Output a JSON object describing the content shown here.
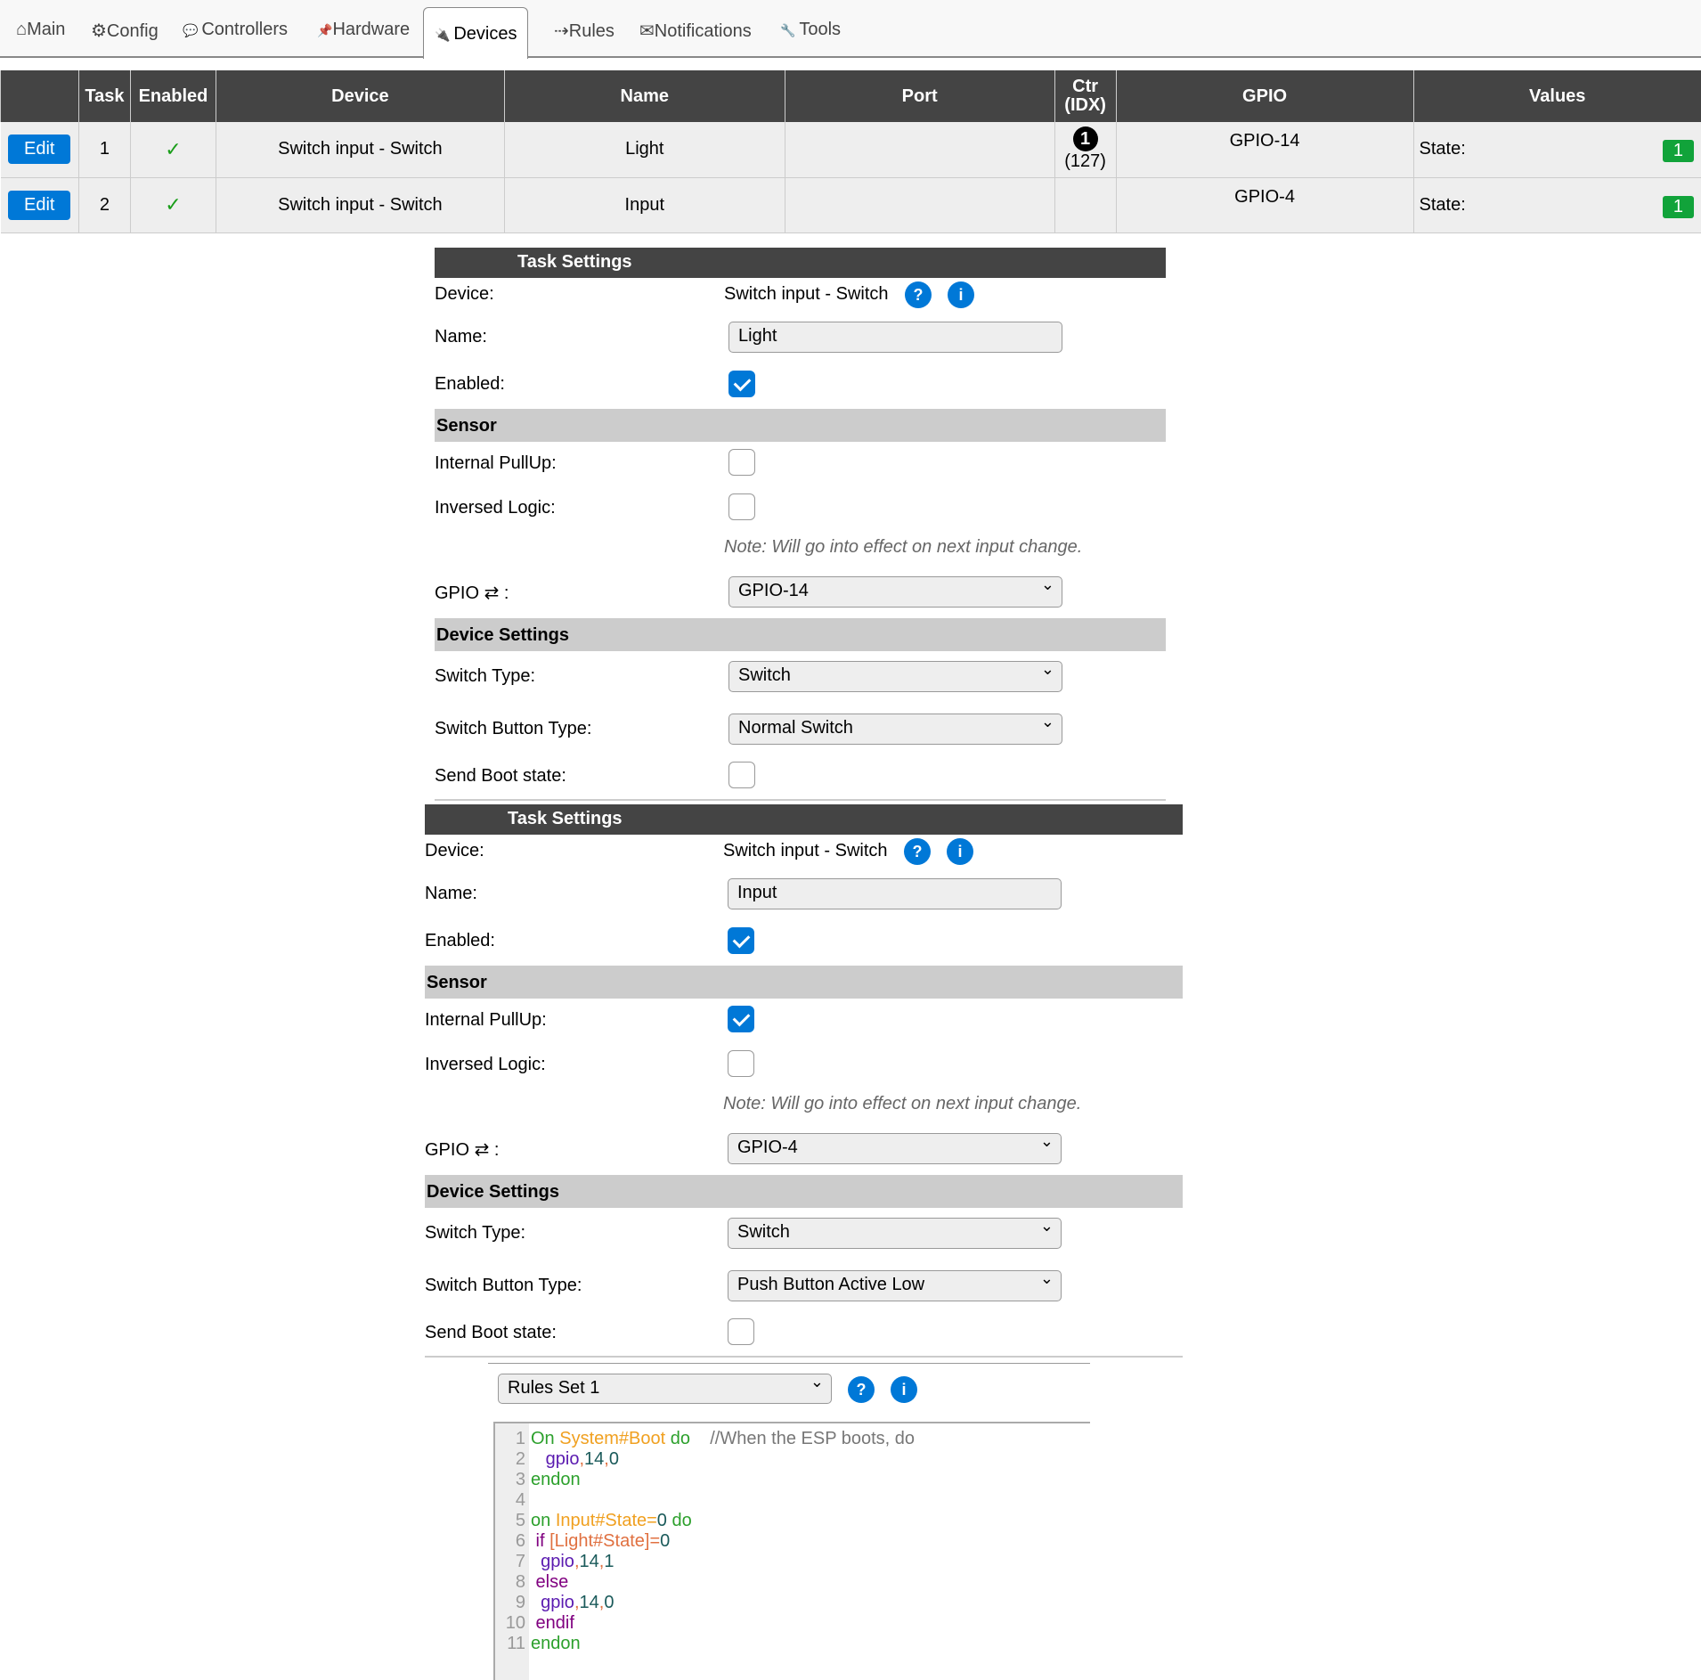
{
  "nav": {
    "tabs": [
      {
        "icon": "home-icon",
        "label": "⌂Main"
      },
      {
        "icon": "gear-icon",
        "label": "⚙Config"
      },
      {
        "icon": "speech-bubble-icon",
        "label": "Controllers"
      },
      {
        "icon": "pin-icon",
        "label": "Hardware"
      },
      {
        "icon": "plug-icon",
        "label": "Devices",
        "active": true
      },
      {
        "icon": "arrow-icon",
        "label": "⇢Rules"
      },
      {
        "icon": "envelope-icon",
        "label": "✉Notifications"
      },
      {
        "icon": "wrench-icon",
        "label": "Tools"
      }
    ]
  },
  "table": {
    "headers": [
      "",
      "Task",
      "Enabled",
      "Device",
      "Name",
      "Port",
      "Ctr (IDX)",
      "GPIO",
      "Values"
    ],
    "rows": [
      {
        "edit": "Edit",
        "task": "1",
        "enabled": "✓",
        "device": "Switch input - Switch",
        "name": "Light",
        "port": "",
        "ctr": "1",
        "idx": "(127)",
        "gpio": "GPIO-14",
        "value_label": "State:",
        "value": "1"
      },
      {
        "edit": "Edit",
        "task": "2",
        "enabled": "✓",
        "device": "Switch input - Switch",
        "name": "Input",
        "port": "",
        "ctr": "",
        "idx": "",
        "gpio": "GPIO-4",
        "value_label": "State:",
        "value": "1"
      }
    ]
  },
  "forms": [
    {
      "title": "Task Settings",
      "device_label": "Device:",
      "device": "Switch input - Switch",
      "name_label": "Name:",
      "name": "Light",
      "enabled_label": "Enabled:",
      "enabled": true,
      "sensor": "Sensor",
      "pullup_label": "Internal PullUp:",
      "pullup": false,
      "inversed_label": "Inversed Logic:",
      "inversed": false,
      "note": "Note: Will go into effect on next input change.",
      "gpio_label": "GPIO ⇄ :",
      "gpio": "GPIO-14",
      "device_settings": "Device Settings",
      "switch_type_label": "Switch Type:",
      "switch_type": "Switch",
      "button_type_label": "Switch Button Type:",
      "button_type": "Normal Switch",
      "boot_label": "Send Boot state:",
      "boot": false
    },
    {
      "title": "Task Settings",
      "device_label": "Device:",
      "device": "Switch input - Switch",
      "name_label": "Name:",
      "name": "Input",
      "enabled_label": "Enabled:",
      "enabled": true,
      "sensor": "Sensor",
      "pullup_label": "Internal PullUp:",
      "pullup": true,
      "inversed_label": "Inversed Logic:",
      "inversed": false,
      "note": "Note: Will go into effect on next input change.",
      "gpio_label": "GPIO ⇄ :",
      "gpio": "GPIO-4",
      "device_settings": "Device Settings",
      "switch_type_label": "Switch Type:",
      "switch_type": "Switch",
      "button_type_label": "Switch Button Type:",
      "button_type": "Push Button Active Low",
      "boot_label": "Send Boot state:",
      "boot": false
    }
  ],
  "rules": {
    "set": "Rules Set 1",
    "lines": [
      [
        [
          "kg",
          "On "
        ],
        [
          "ko",
          "System#Boot"
        ],
        [
          "kg",
          " do"
        ],
        [
          "kc",
          "    //When the ESP boots, do"
        ]
      ],
      [
        [
          "kp",
          "   gpio"
        ],
        [
          "kr",
          ","
        ],
        [
          "kv",
          "14"
        ],
        [
          "kr",
          ","
        ],
        [
          "kv",
          "0"
        ]
      ],
      [
        [
          "kg",
          "endon"
        ]
      ],
      [],
      [
        [
          "kg",
          "on "
        ],
        [
          "ko",
          "Input#State="
        ],
        [
          "kv",
          "0"
        ],
        [
          "kg",
          " do"
        ]
      ],
      [
        [
          "km",
          " if "
        ],
        [
          "kr",
          "[Light#State]"
        ],
        [
          "kr",
          "="
        ],
        [
          "kv",
          "0"
        ]
      ],
      [
        [
          "kp",
          "  gpio"
        ],
        [
          "kr",
          ","
        ],
        [
          "kv",
          "14"
        ],
        [
          "kr",
          ","
        ],
        [
          "kv",
          "1"
        ]
      ],
      [
        [
          "km",
          " else"
        ]
      ],
      [
        [
          "kp",
          "  gpio"
        ],
        [
          "kr",
          ","
        ],
        [
          "kv",
          "14"
        ],
        [
          "kr",
          ","
        ],
        [
          "kv",
          "0"
        ]
      ],
      [
        [
          "km",
          " endif"
        ]
      ],
      [
        [
          "kg",
          "endon"
        ]
      ]
    ]
  }
}
